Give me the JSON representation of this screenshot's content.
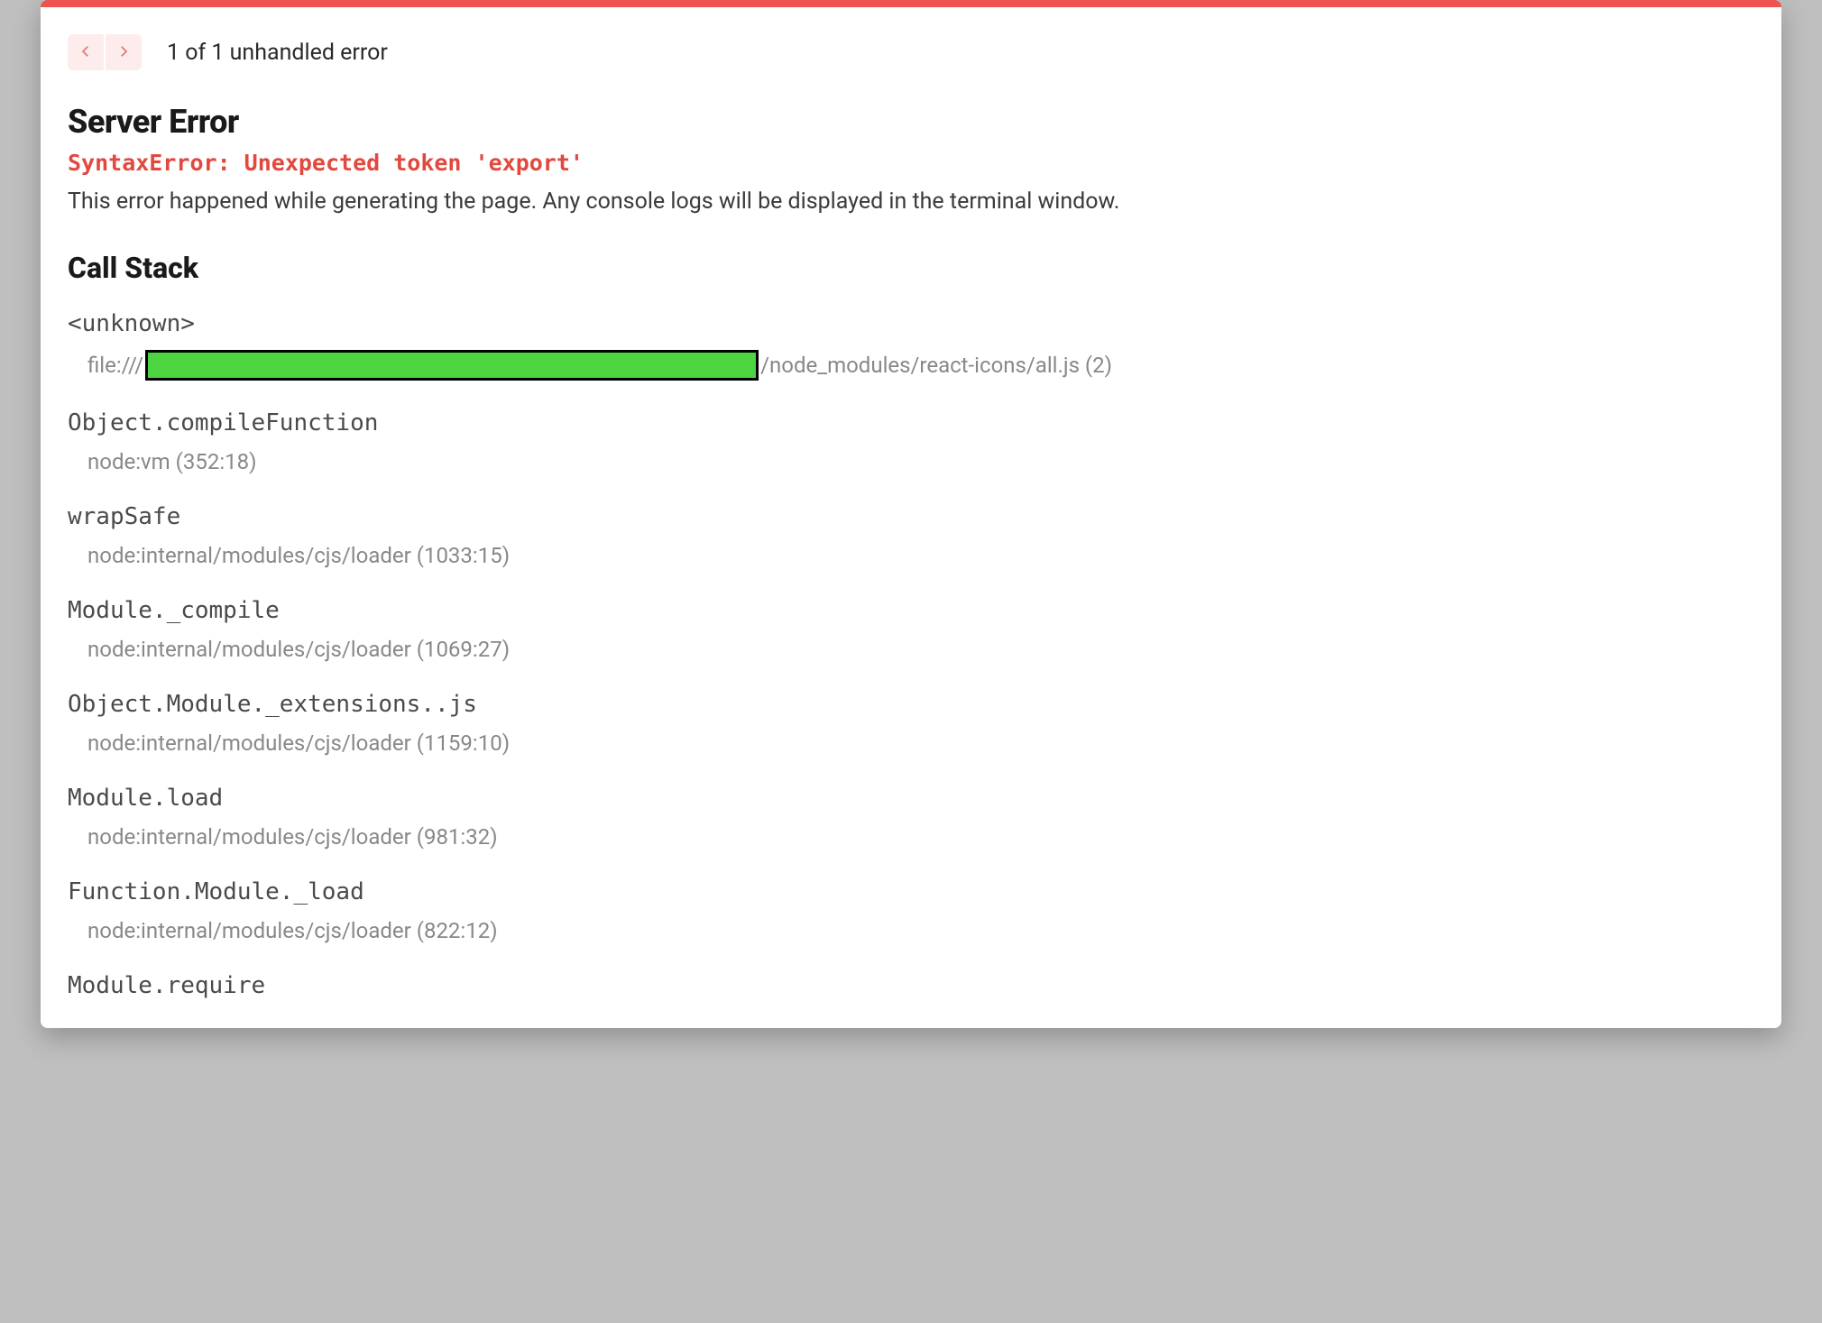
{
  "nav": {
    "counter": "1 of 1 unhandled error"
  },
  "header": {
    "title": "Server Error",
    "error_message": "SyntaxError: Unexpected token 'export'",
    "description": "This error happened while generating the page. Any console logs will be displayed in the terminal window."
  },
  "callstack": {
    "title": "Call Stack",
    "frames": [
      {
        "fn": "<unknown>",
        "loc_prefix": "file:///",
        "redacted": true,
        "loc_suffix": "/node_modules/react-icons/all.js (2)"
      },
      {
        "fn": "Object.compileFunction",
        "loc": "node:vm (352:18)"
      },
      {
        "fn": "wrapSafe",
        "loc": "node:internal/modules/cjs/loader (1033:15)"
      },
      {
        "fn": "Module._compile",
        "loc": "node:internal/modules/cjs/loader (1069:27)"
      },
      {
        "fn": "Object.Module._extensions..js",
        "loc": "node:internal/modules/cjs/loader (1159:10)"
      },
      {
        "fn": "Module.load",
        "loc": "node:internal/modules/cjs/loader (981:32)"
      },
      {
        "fn": "Function.Module._load",
        "loc": "node:internal/modules/cjs/loader (822:12)"
      },
      {
        "fn": "Module.require",
        "loc": ""
      }
    ]
  }
}
